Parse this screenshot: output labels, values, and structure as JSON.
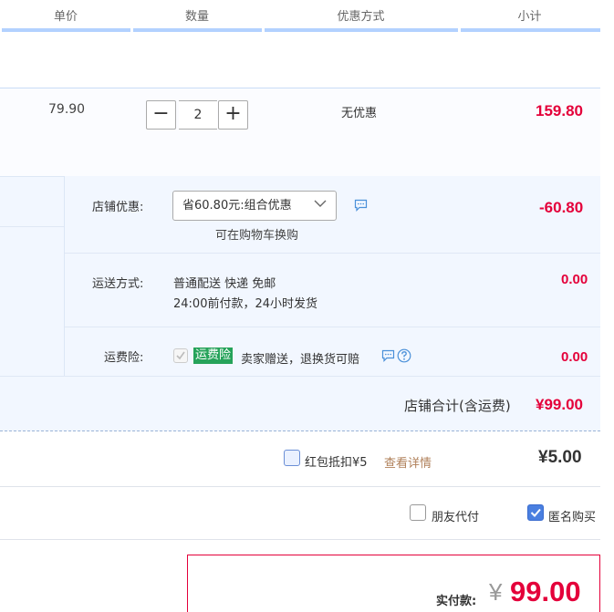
{
  "header": {
    "unit_price": "单价",
    "quantity": "数量",
    "discount": "优惠方式",
    "subtotal": "小计"
  },
  "item": {
    "unit_price": "79.90",
    "quantity": "2",
    "minus": "−",
    "plus": "+",
    "discount": "无优惠",
    "subtotal": "159.80"
  },
  "shop_discount": {
    "label": "店铺优惠:",
    "selected": "省60.80元:组合优惠",
    "hint": "可在购物车换购",
    "amount": "-60.80"
  },
  "shipping": {
    "label": "运送方式:",
    "line1": "普通配送 快递 免邮",
    "line2": "24:00前付款，24小时发货",
    "amount": "0.00"
  },
  "insurance": {
    "label": "运费险:",
    "badge": "运费险",
    "text": "卖家赠送，退换货可赔",
    "amount": "0.00"
  },
  "shop_total": {
    "label": "店铺合计(含运费)",
    "amount": "¥99.00"
  },
  "red_packet": {
    "label": "红包抵扣¥5",
    "details_link": "查看详情",
    "amount": "¥5.00"
  },
  "options": {
    "friend_pay": "朋友代付",
    "anonymous": "匿名购买"
  },
  "payment": {
    "label": "实付款:",
    "currency": "¥",
    "amount": "99.00"
  },
  "colors": {
    "accent_red": "#e4003a",
    "header_line": "#b2d1ff",
    "badge_green": "#26a35a",
    "link_brown": "#b0805a"
  }
}
